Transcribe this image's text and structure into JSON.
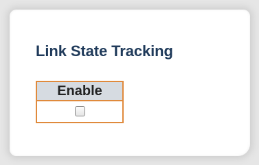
{
  "section": {
    "title": "Link State Tracking"
  },
  "table": {
    "header": "Enable",
    "enable_checked": false
  },
  "colors": {
    "title": "#1f3a5a",
    "table_border": "#e08a3c",
    "header_background": "#d6dbe1"
  }
}
